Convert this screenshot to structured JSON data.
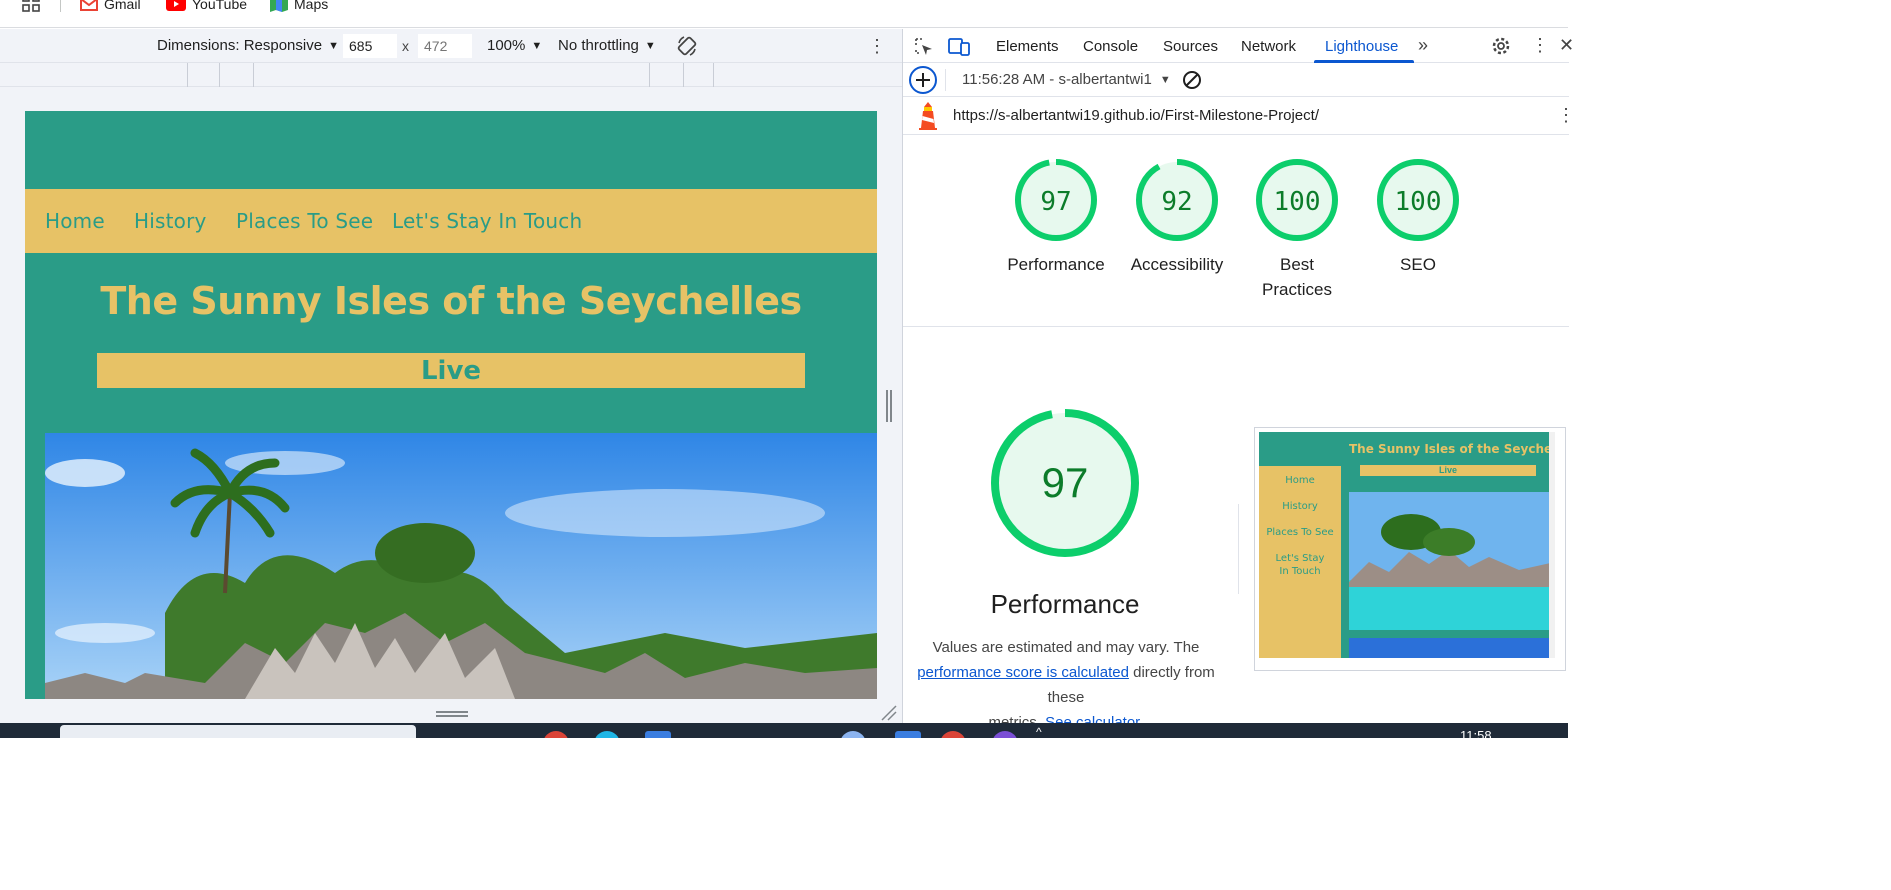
{
  "bookmarks": [
    {
      "label": "Gmail",
      "icon": "gmail-icon"
    },
    {
      "label": "YouTube",
      "icon": "youtube-icon"
    },
    {
      "label": "Maps",
      "icon": "maps-icon"
    }
  ],
  "device_toolbar": {
    "dimensions_label": "Dimensions: Responsive",
    "width": "685",
    "height_placeholder": "472",
    "times": "x",
    "zoom": "100%",
    "throttling": "No throttling"
  },
  "site": {
    "nav": [
      "Home",
      "History",
      "Places To See",
      "Let's Stay In Touch"
    ],
    "title": "The Sunny Isles of the Seychelles",
    "banner": "Live"
  },
  "devtools": {
    "tabs": [
      "Elements",
      "Console",
      "Sources",
      "Network",
      "Lighthouse"
    ],
    "active_tab": "Lighthouse",
    "report_label": "11:56:28 AM - s-albertantwi1",
    "url": "https://s-albertantwi19.github.io/First-Milestone-Project/"
  },
  "scores": [
    {
      "value": 97,
      "label": "Performance"
    },
    {
      "value": 92,
      "label": "Accessibility"
    },
    {
      "value": 100,
      "label": "Best Practices"
    },
    {
      "value": 100,
      "label": "SEO"
    }
  ],
  "performance": {
    "score": 97,
    "title": "Performance",
    "desc_1": "Values are estimated and may vary. The",
    "desc_link_1": "performance score is calculated",
    "desc_2": "directly from these",
    "desc_3": "metrics.",
    "desc_link_2": "See calculator."
  },
  "thumbnail": {
    "title": "The Sunny Isles of the Seychelles",
    "banner": "Live",
    "nav": [
      "Home",
      "History",
      "Places To See",
      "Let's Stay In Touch"
    ]
  },
  "taskbar": {
    "time": "11:58"
  },
  "colors": {
    "teal": "#2a9c87",
    "gold": "#e7c266",
    "score_green": "#0cce6b",
    "devtools_blue": "#0b57d0"
  }
}
